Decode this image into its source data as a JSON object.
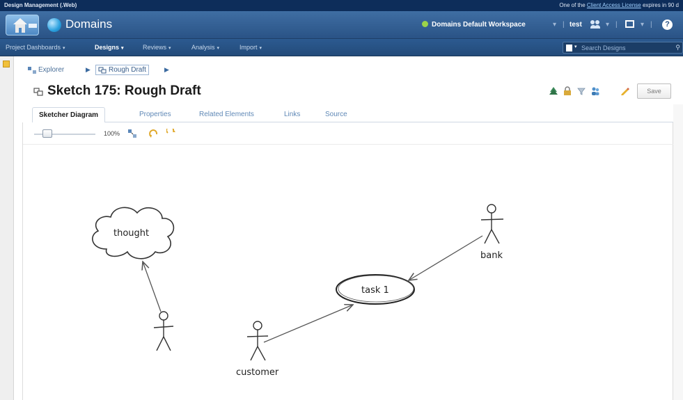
{
  "topbar": {
    "app_name": "Design Management (.Web)",
    "notice_prefix": "One of the ",
    "notice_link": "Client Access License",
    "notice_suffix": " expires in 90 d"
  },
  "header": {
    "title": "Domains",
    "workspace": "Domains Default Workspace",
    "user": "test",
    "help": "?"
  },
  "nav": {
    "items": [
      {
        "label": "Project Dashboards"
      },
      {
        "label": "Designs"
      },
      {
        "label": "Reviews"
      },
      {
        "label": "Analysis"
      },
      {
        "label": "Import"
      }
    ],
    "search_placeholder": "Search Designs"
  },
  "breadcrumb": {
    "root": "Explorer",
    "current": "Rough Draft"
  },
  "page": {
    "title": "Sketch 175: Rough Draft",
    "save_label": "Save"
  },
  "tabs": [
    {
      "label": "Sketcher Diagram"
    },
    {
      "label": "Properties"
    },
    {
      "label": "Related Elements"
    },
    {
      "label": "Links"
    },
    {
      "label": "Source"
    }
  ],
  "canvas_toolbar": {
    "zoom": "100%"
  },
  "diagram": {
    "thought": "thought",
    "task": "task 1",
    "bank": "bank",
    "customer": "customer"
  },
  "colors": {
    "header": "#2a5386",
    "nav": "#234b7a",
    "link": "#5f88b6"
  }
}
